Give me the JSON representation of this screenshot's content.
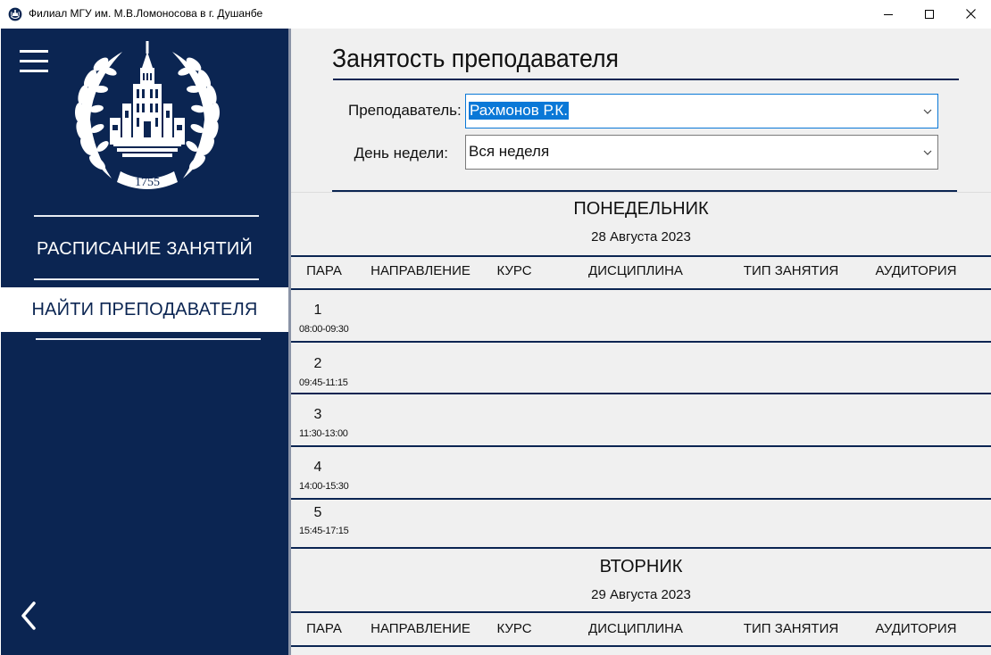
{
  "window": {
    "title": "Филиал МГУ им. М.В.Ломоносова в г. Душанбе"
  },
  "sidebar": {
    "logo_year": "1755",
    "items": [
      {
        "label": "РАСПИСАНИЕ ЗАНЯТИЙ",
        "active": false
      },
      {
        "label": "НАЙТИ ПРЕПОДАВАТЕЛЯ",
        "active": true
      }
    ],
    "icons": {
      "menu": "hamburger-icon",
      "back": "chevron-left-icon"
    }
  },
  "main": {
    "title": "Занятость преподавателя",
    "form": {
      "teacher_label": "Преподаватель:",
      "teacher_value": "Рахмонов Р.К.",
      "day_label": "День недели:",
      "day_value": "Вся неделя"
    },
    "columns": [
      "ПАРА",
      "НАПРАВЛЕНИЕ",
      "КУРС",
      "ДИСЦИПЛИНА",
      "ТИП ЗАНЯТИЯ",
      "АУДИТОРИЯ"
    ],
    "days": [
      {
        "name": "ПОНЕДЕЛЬНИК",
        "date": "28 Августа 2023",
        "periods": [
          {
            "num": "1",
            "time": "08:00-09:30"
          },
          {
            "num": "2",
            "time": "09:45-11:15"
          },
          {
            "num": "3",
            "time": "11:30-13:00"
          },
          {
            "num": "4",
            "time": "14:00-15:30"
          },
          {
            "num": "5",
            "time": "15:45-17:15"
          }
        ]
      },
      {
        "name": "ВТОРНИК",
        "date": "29 Августа 2023",
        "periods": []
      }
    ]
  },
  "colors": {
    "navy": "#0b2552",
    "selection": "#0a78d7",
    "content_bg": "#f0f0f0"
  }
}
